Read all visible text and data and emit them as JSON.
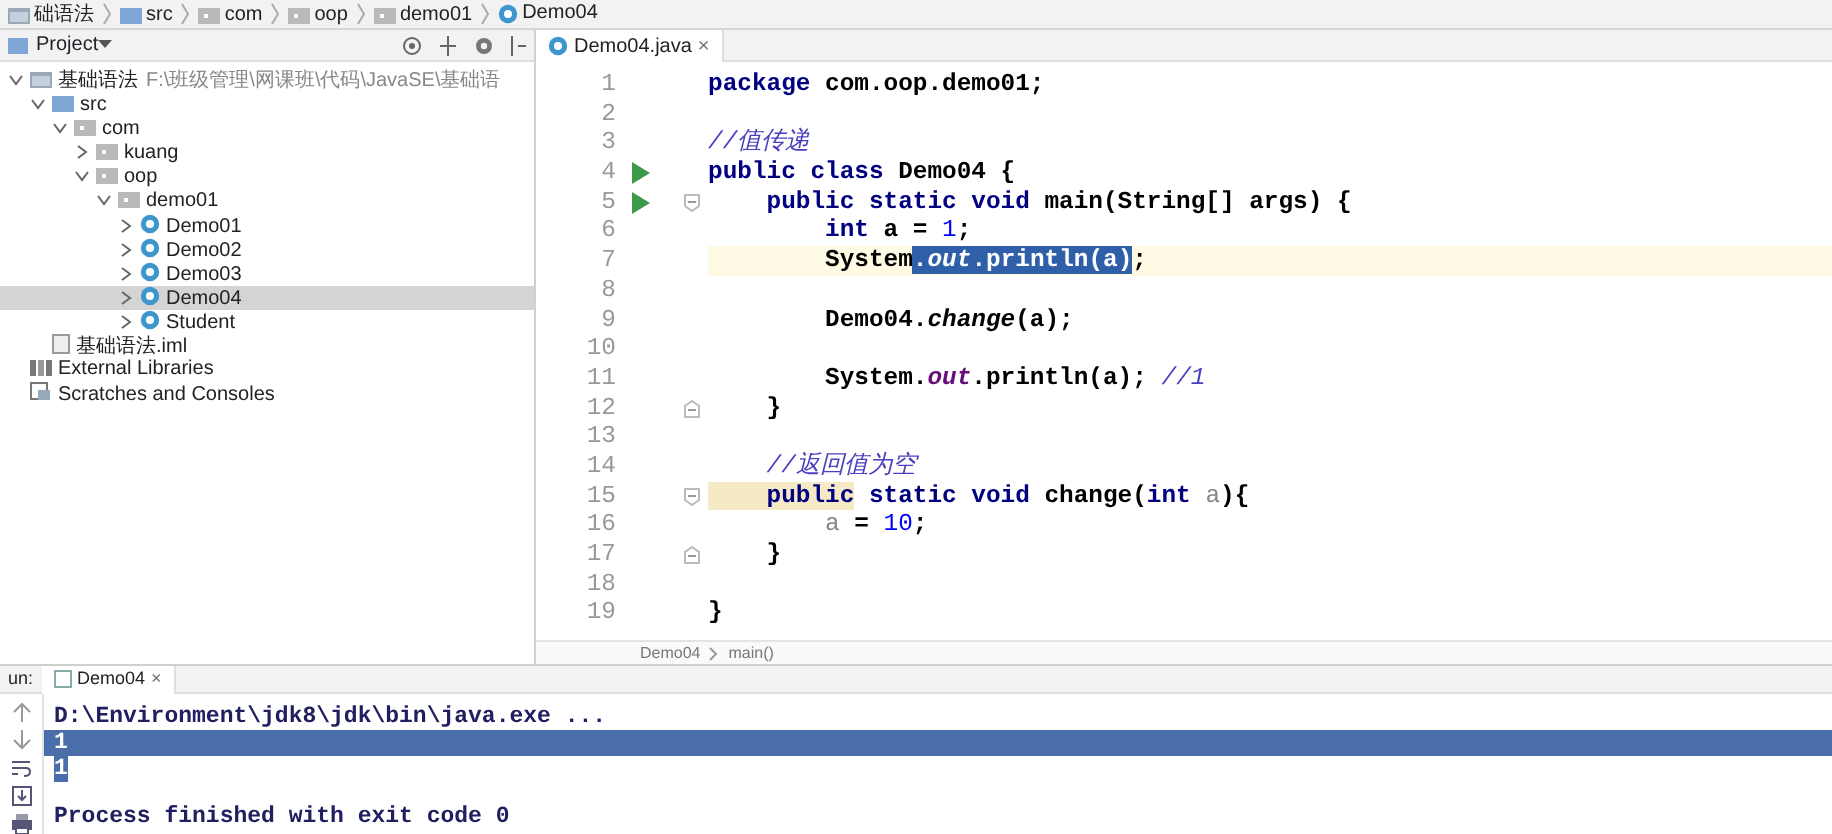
{
  "navbar": {
    "crumbs": [
      {
        "text": "础语法",
        "kind": "module"
      },
      {
        "text": "src",
        "kind": "folder"
      },
      {
        "text": "com",
        "kind": "package"
      },
      {
        "text": "oop",
        "kind": "package"
      },
      {
        "text": "demo01",
        "kind": "package"
      },
      {
        "text": "Demo04",
        "kind": "class"
      }
    ]
  },
  "project": {
    "title": "Project",
    "tree": [
      {
        "label": "基础语法",
        "path": "F:\\班级管理\\网课班\\代码\\JavaSE\\基础语",
        "kind": "module",
        "expanded": true,
        "selected": false,
        "children": [
          {
            "label": "src",
            "kind": "folder",
            "expanded": true,
            "selected": false,
            "children": [
              {
                "label": "com",
                "kind": "package",
                "expanded": true,
                "selected": false,
                "children": [
                  {
                    "label": "kuang",
                    "kind": "package",
                    "expanded": false,
                    "selected": false
                  },
                  {
                    "label": "oop",
                    "kind": "package",
                    "expanded": true,
                    "selected": false,
                    "children": [
                      {
                        "label": "demo01",
                        "kind": "package",
                        "expanded": true,
                        "selected": false,
                        "children": [
                          {
                            "label": "Demo01",
                            "kind": "class",
                            "expanded": false,
                            "selected": false
                          },
                          {
                            "label": "Demo02",
                            "kind": "class",
                            "expanded": false,
                            "selected": false
                          },
                          {
                            "label": "Demo03",
                            "kind": "class",
                            "expanded": false,
                            "selected": false
                          },
                          {
                            "label": "Demo04",
                            "kind": "class",
                            "expanded": false,
                            "selected": true
                          },
                          {
                            "label": "Student",
                            "kind": "class",
                            "expanded": false,
                            "selected": false
                          }
                        ]
                      }
                    ]
                  }
                ]
              }
            ]
          },
          {
            "label": "基础语法.iml",
            "kind": "file",
            "selected": false
          }
        ]
      },
      {
        "label": "External Libraries",
        "kind": "library",
        "selected": false
      },
      {
        "label": "Scratches and Consoles",
        "kind": "scratch",
        "selected": false
      }
    ]
  },
  "editor": {
    "tabs": [
      {
        "label": "Demo04.java",
        "close": "×",
        "selected": true
      }
    ],
    "lines": [
      {
        "number": "1",
        "tokens": [
          {
            "kind": "kw",
            "text": "package"
          },
          {
            "kind": "plain",
            "text": " com.oop.demo01;"
          }
        ]
      },
      {
        "number": "2"
      },
      {
        "number": "3",
        "tokens": [
          {
            "kind": "comment",
            "text": "//值传递"
          }
        ]
      },
      {
        "number": "4",
        "run": true,
        "tokens": [
          {
            "kind": "kw",
            "text": "public class"
          },
          {
            "kind": "plain",
            "text": " Demo04 {"
          }
        ]
      },
      {
        "number": "5",
        "run": true,
        "fold_start": true,
        "tokens": [
          {
            "kind": "kw",
            "text": "    public static void"
          },
          {
            "kind": "plain",
            "text": " main(String[] args) {"
          }
        ]
      },
      {
        "number": "6",
        "tokens": [
          {
            "kind": "kw",
            "text": "        int"
          },
          {
            "kind": "plain",
            "text": " a = "
          },
          {
            "kind": "num",
            "text": "1"
          },
          {
            "kind": "plain",
            "text": ";"
          }
        ]
      },
      {
        "number": "7",
        "current": true,
        "tokens": [
          {
            "kind": "plain",
            "text": "        System"
          },
          {
            "kind": "sel",
            "text": "."
          },
          {
            "kind": "selfield",
            "text": "out"
          },
          {
            "kind": "sel",
            "text": ".println(a)"
          },
          {
            "kind": "plain",
            "text": ";"
          }
        ]
      },
      {
        "number": "8"
      },
      {
        "number": "9",
        "tokens": [
          {
            "kind": "plain",
            "text": "        Demo04."
          },
          {
            "kind": "call",
            "text": "change"
          },
          {
            "kind": "plain",
            "text": "(a);"
          }
        ]
      },
      {
        "number": "10"
      },
      {
        "number": "11",
        "tokens": [
          {
            "kind": "plain",
            "text": "        System."
          },
          {
            "kind": "field",
            "text": "out"
          },
          {
            "kind": "plain",
            "text": ".println(a); "
          },
          {
            "kind": "comment",
            "text": "//1"
          }
        ]
      },
      {
        "number": "12",
        "fold_end": true,
        "tokens": [
          {
            "kind": "plain",
            "text": "    }"
          }
        ]
      },
      {
        "number": "13"
      },
      {
        "number": "14",
        "tokens": [
          {
            "kind": "comment",
            "text": "    //返回值为空"
          }
        ]
      },
      {
        "number": "15",
        "fold_start": true,
        "tokens": [
          {
            "kind": "kwmark",
            "text": "    public"
          },
          {
            "kind": "kw",
            "text": " static void"
          },
          {
            "kind": "plain",
            "text": " change("
          },
          {
            "kind": "kw",
            "text": "int"
          },
          {
            "kind": "param",
            "text": " a"
          },
          {
            "kind": "plain",
            "text": "){"
          }
        ]
      },
      {
        "number": "16",
        "tokens": [
          {
            "kind": "param",
            "text": "        a"
          },
          {
            "kind": "plain",
            "text": " = "
          },
          {
            "kind": "num",
            "text": "10"
          },
          {
            "kind": "plain",
            "text": ";"
          }
        ]
      },
      {
        "number": "17",
        "fold_end": true,
        "tokens": [
          {
            "kind": "plain",
            "text": "    }"
          }
        ]
      },
      {
        "number": "18"
      },
      {
        "number": "19",
        "tokens": [
          {
            "kind": "plain",
            "text": "}"
          }
        ]
      }
    ],
    "breadcrumb": [
      "Demo04",
      "main()"
    ]
  },
  "run": {
    "label": "un:",
    "tabs": [
      {
        "label": "Demo04",
        "close": "×",
        "selected": true
      }
    ],
    "console": [
      {
        "kind": "command",
        "text": "D:\\Environment\\jdk8\\jdk\\bin\\java.exe ..."
      },
      {
        "kind": "selected-line",
        "text": "1"
      },
      {
        "kind": "selected-text",
        "text": "1"
      },
      {
        "kind": "status",
        "text": "Process finished with exit code 0"
      }
    ]
  }
}
